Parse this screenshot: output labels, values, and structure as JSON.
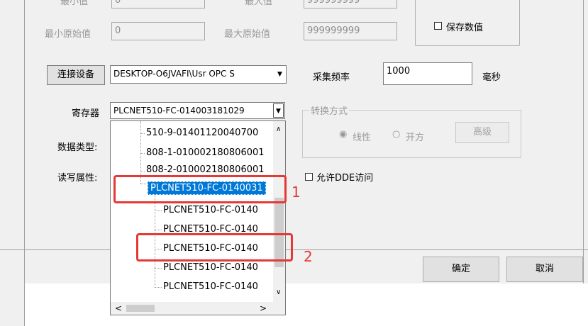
{
  "top_row": {
    "min_value_label": "最小值",
    "min_value": "0",
    "max_value_label": "最大值",
    "max_value": "999999999"
  },
  "raw_row": {
    "min_raw_label": "最小原始值",
    "min_raw_value": "0",
    "max_raw_label": "最大原始值",
    "max_raw_value": "999999999",
    "save_value_label": "保存数值"
  },
  "connect": {
    "button_label": "连接设备",
    "device_value": "DESKTOP-O6JVAFI\\Usr OPC S",
    "sample_rate_label": "采集频率",
    "sample_rate_value": "1000",
    "unit_label": "毫秒"
  },
  "register": {
    "label": "寄存器",
    "value": "PLCNET510-FC-014003181029"
  },
  "conversion": {
    "group_label": "转换方式",
    "linear_label": "线性",
    "sqrt_label": "开方",
    "advanced_label": "高级"
  },
  "data_type_label": "数据类型:",
  "rw_attr_label": "读写属性:",
  "dde_label": "允许DDE访问",
  "footer": {
    "ok_label": "确定",
    "cancel_label": "取消"
  },
  "tree": {
    "items": [
      "510-9-01401120040700",
      "808-1-010002180806001",
      "808-2-010002180806001",
      "PLCNET510-FC-0140031",
      "PLCNET510-FC-0140",
      "PLCNET510-FC-0140",
      "PLCNET510-FC-0140",
      "PLCNET510-FC-0140",
      "PLCNET510-FC-0140"
    ]
  },
  "annotations": {
    "marker_1": "1",
    "marker_2": "2"
  },
  "colors": {
    "selection": "#0078d7",
    "annotation_red": "#e53935"
  }
}
